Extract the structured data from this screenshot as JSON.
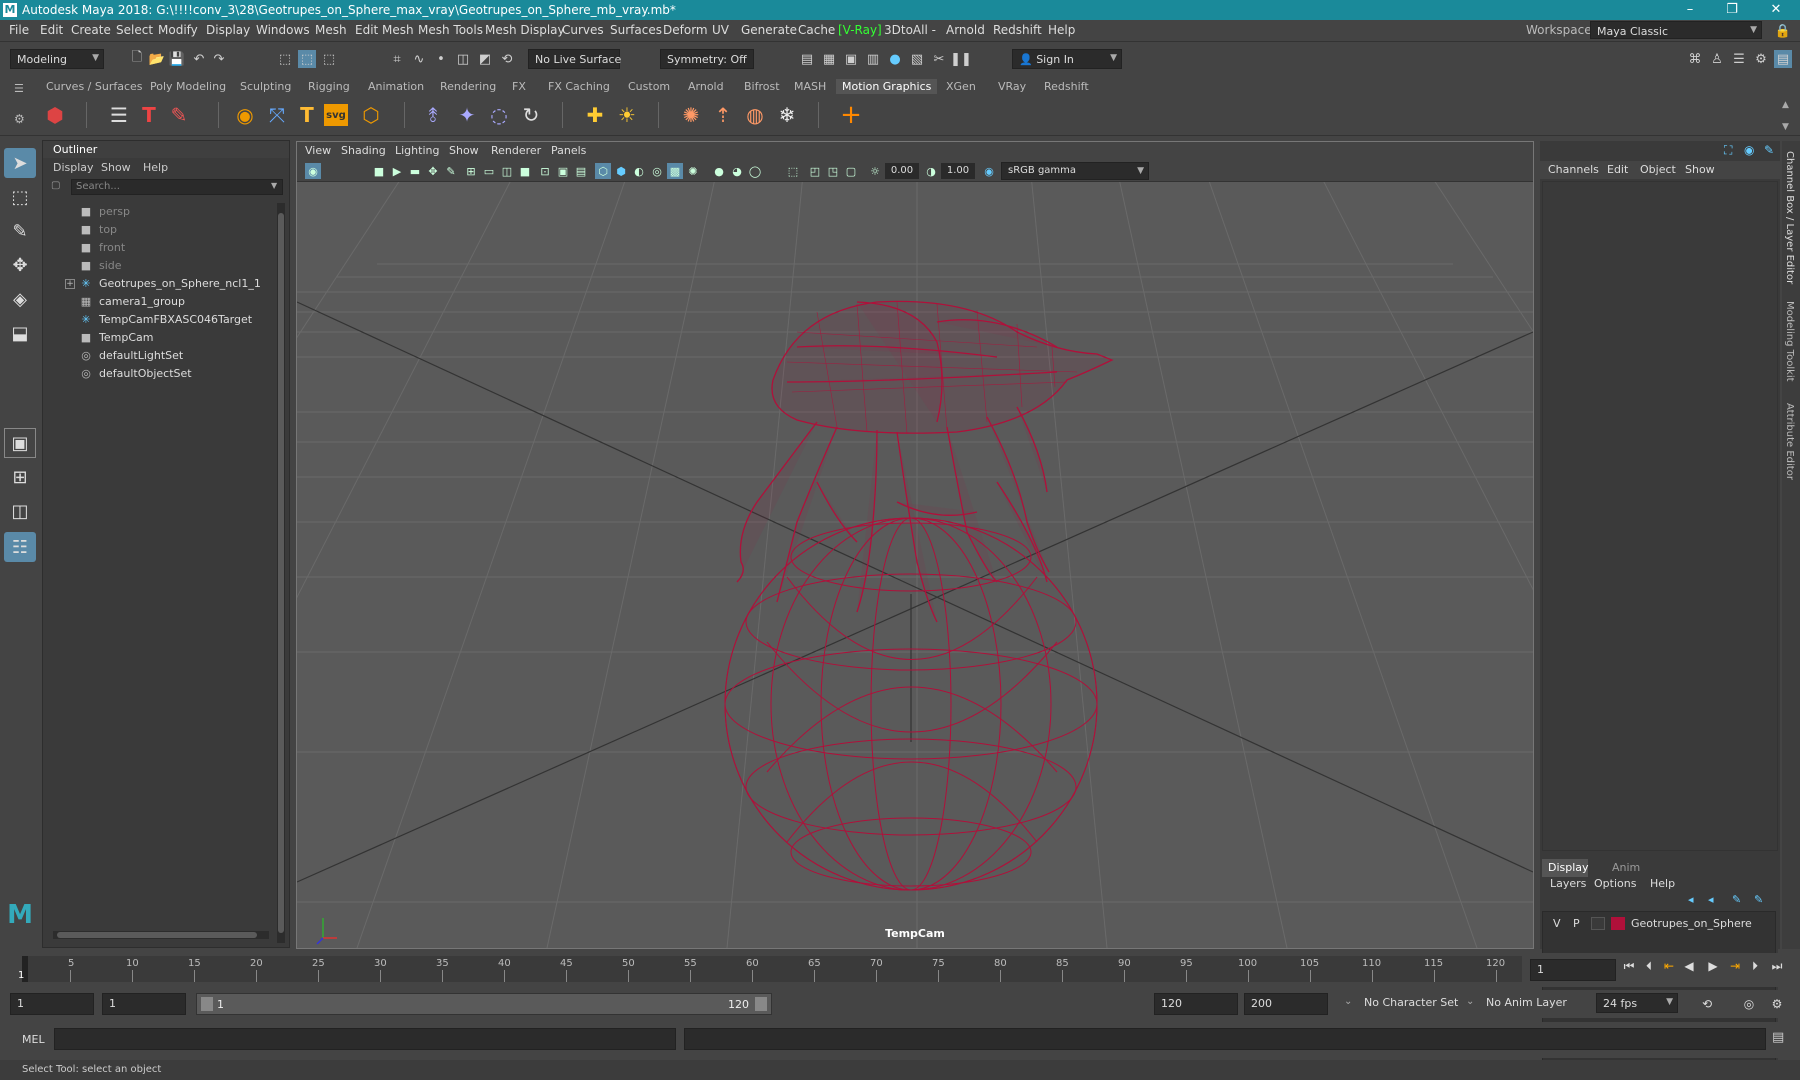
{
  "window": {
    "title": "Autodesk Maya 2018: G:\\!!!!conv_3\\28\\Geotrupes_on_Sphere_max_vray\\Geotrupes_on_Sphere_mb_vray.mb*",
    "logo": "M",
    "minimize": "–",
    "restore": "❐",
    "close": "✕"
  },
  "menubar": {
    "items": [
      "File",
      "Edit",
      "Create",
      "Select",
      "Modify",
      "Display",
      "Windows",
      "Mesh",
      "Edit Mesh",
      "Mesh Tools",
      "Mesh Display",
      "Curves",
      "Surfaces",
      "Deform",
      "UV",
      "Generate",
      "Cache",
      "[V-Ray]",
      "3DtoAll -",
      "Arnold",
      "Redshift",
      "Help"
    ],
    "workspace_label": "Workspace :",
    "workspace_value": "Maya Classic"
  },
  "statusline": {
    "mode": "Modeling",
    "live_surface": "No Live Surface",
    "symmetry": "Symmetry: Off",
    "sign_in": "Sign In"
  },
  "shelf": {
    "tabs": [
      "Curves / Surfaces",
      "Poly Modeling",
      "Sculpting",
      "Rigging",
      "Animation",
      "Rendering",
      "FX",
      "FX Caching",
      "Custom",
      "Arnold",
      "Bifrost",
      "MASH",
      "Motion Graphics",
      "XGen",
      "VRay",
      "Redshift"
    ],
    "active_tab": "Motion Graphics",
    "svg_label": "svg"
  },
  "outliner": {
    "title": "Outliner",
    "menu": [
      "Display",
      "Show",
      "Help"
    ],
    "search_placeholder": "Search...",
    "items": [
      {
        "label": "persp",
        "icon": "camera-icon",
        "dim": true
      },
      {
        "label": "top",
        "icon": "camera-icon",
        "dim": true
      },
      {
        "label": "front",
        "icon": "camera-icon",
        "dim": true
      },
      {
        "label": "side",
        "icon": "camera-icon",
        "dim": true
      },
      {
        "label": "Geotrupes_on_Sphere_ncl1_1",
        "icon": "transform-icon",
        "dim": false,
        "expandable": true
      },
      {
        "label": "camera1_group",
        "icon": "group-icon",
        "dim": false
      },
      {
        "label": "TempCamFBXASC046Target",
        "icon": "transform-icon",
        "dim": false
      },
      {
        "label": "TempCam",
        "icon": "camera-icon",
        "dim": false
      },
      {
        "label": "defaultLightSet",
        "icon": "set-icon",
        "dim": false
      },
      {
        "label": "defaultObjectSet",
        "icon": "set-icon",
        "dim": false
      }
    ]
  },
  "viewport": {
    "menu": [
      "View",
      "Shading",
      "Lighting",
      "Show",
      "Renderer",
      "Panels"
    ],
    "exposure": "0.00",
    "gamma": "1.00",
    "color_space": "sRGB gamma",
    "camera_name": "TempCam",
    "wire_color": "#b0103a"
  },
  "channelbox": {
    "menu": [
      "Channels",
      "Edit",
      "Object",
      "Show"
    ],
    "side_tabs": [
      "Channel Box / Layer Editor",
      "Modeling Toolkit",
      "Attribute Editor"
    ],
    "layer_tabs": [
      "Display",
      "Anim"
    ],
    "layer_menu": [
      "Layers",
      "Options",
      "Help"
    ],
    "layer": {
      "v": "V",
      "p": "P",
      "name": "Geotrupes_on_Sphere",
      "color": "#b0103a"
    }
  },
  "timeslider": {
    "ticks": [
      "5",
      "10",
      "15",
      "20",
      "25",
      "30",
      "35",
      "40",
      "45",
      "50",
      "55",
      "60",
      "65",
      "70",
      "75",
      "80",
      "85",
      "90",
      "95",
      "100",
      "105",
      "110",
      "115",
      "120"
    ],
    "current_frame_marker": "1",
    "current_frame": "1"
  },
  "range": {
    "start": "1",
    "playback_start": "1",
    "slider_start": "1",
    "slider_end": "120",
    "playback_end": "120",
    "end": "200",
    "character_set": "No Character Set",
    "anim_layer": "No Anim Layer",
    "fps": "24 fps"
  },
  "cmdline": {
    "label": "MEL"
  },
  "helpline": {
    "text": "Select Tool: select an object"
  }
}
